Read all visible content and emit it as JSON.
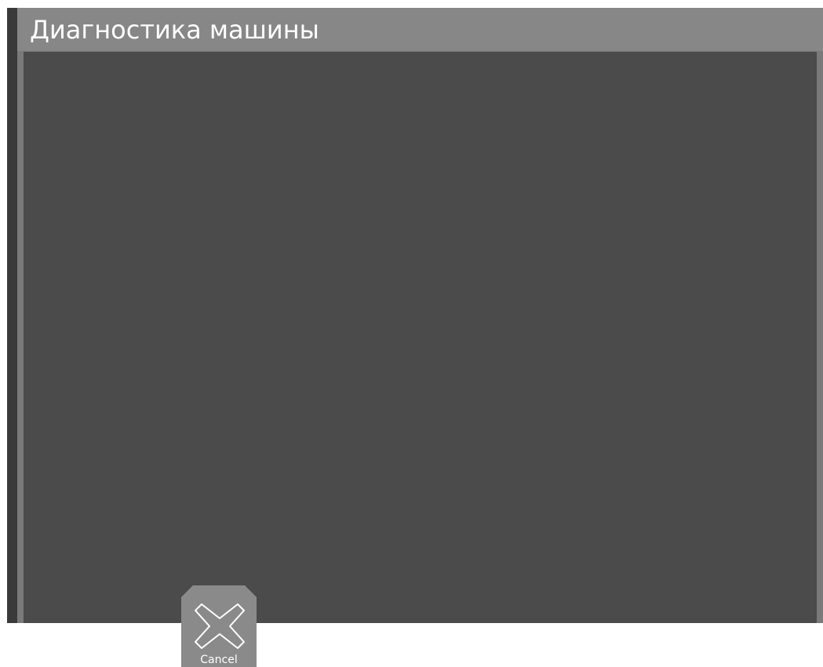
{
  "window": {
    "title": "Диагностика машины"
  },
  "buttons": {
    "cancel_label": "Cancel",
    "cancel_icon": "close-x-icon"
  },
  "colors": {
    "title_bar": "#878787",
    "panel": "#4b4b4b",
    "button": "#8a8a8a",
    "text": "#ffffff"
  }
}
